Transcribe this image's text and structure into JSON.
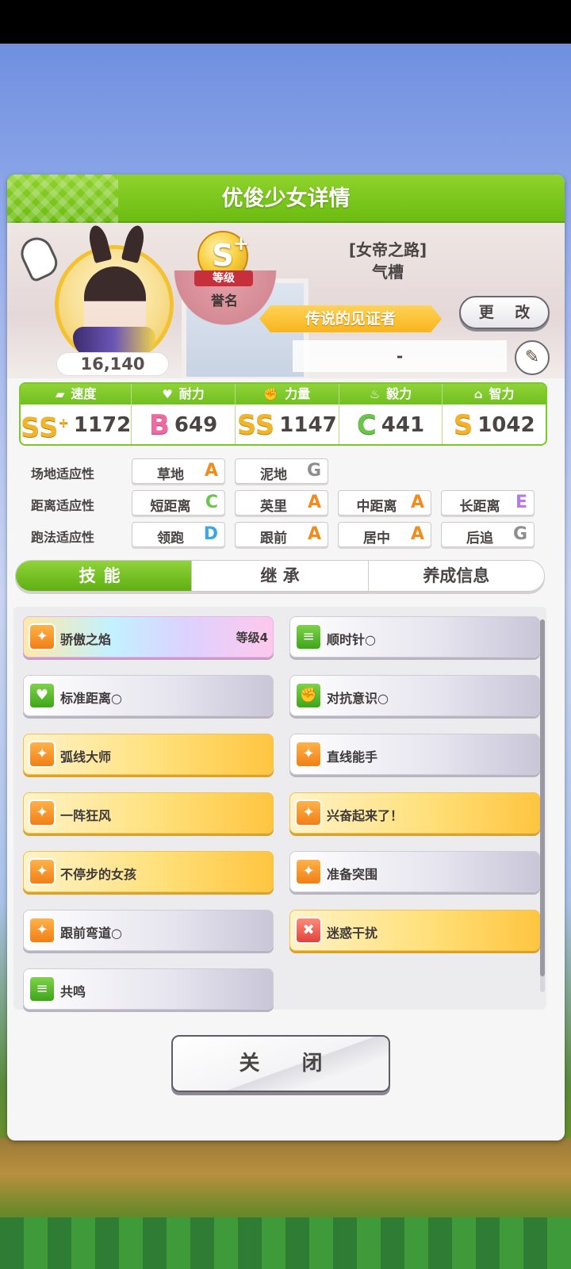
{
  "dialog": {
    "title": "优俊少女详情"
  },
  "profile": {
    "score": "16,140",
    "rank": {
      "letter": "S",
      "modifier": "+",
      "ribbon": "等级",
      "caption": "誉名"
    },
    "epithet_line1": "[女帝之路]",
    "epithet_line2": "气槽",
    "title_plate": "传说的见证者",
    "change_label": "更 改",
    "subtitle": "-"
  },
  "stats": [
    {
      "name": "速度",
      "icon": "shoe-icon",
      "grade": "SS",
      "grade_plus": "+",
      "value": "1172"
    },
    {
      "name": "耐力",
      "icon": "heart-icon",
      "grade": "B",
      "value": "649"
    },
    {
      "name": "力量",
      "icon": "arm-icon",
      "grade": "SS",
      "value": "1147"
    },
    {
      "name": "毅力",
      "icon": "flame-icon",
      "grade": "C",
      "value": "441"
    },
    {
      "name": "智力",
      "icon": "graduation-cap-icon",
      "grade": "S",
      "value": "1042"
    }
  ],
  "aptitude": {
    "track": {
      "label": "场地适应性",
      "items": [
        {
          "name": "草地",
          "rank": "A"
        },
        {
          "name": "泥地",
          "rank": "G"
        }
      ]
    },
    "distance": {
      "label": "距离适应性",
      "items": [
        {
          "name": "短距离",
          "rank": "C"
        },
        {
          "name": "英里",
          "rank": "A"
        },
        {
          "name": "中距离",
          "rank": "A"
        },
        {
          "name": "长距离",
          "rank": "E"
        }
      ]
    },
    "style": {
      "label": "跑法适应性",
      "items": [
        {
          "name": "领跑",
          "rank": "D"
        },
        {
          "name": "跟前",
          "rank": "A"
        },
        {
          "name": "居中",
          "rank": "A"
        },
        {
          "name": "后追",
          "rank": "G"
        }
      ]
    }
  },
  "tabs": {
    "skills": "技能",
    "inherit": "继 承",
    "training": "养成信息"
  },
  "skills": [
    {
      "name": "骄傲之焰",
      "level": "等级4",
      "style": "rainbow",
      "icon": "orange"
    },
    {
      "name": "顺时针○",
      "style": "silver",
      "icon": "green"
    },
    {
      "name": "标准距离○",
      "style": "silver",
      "icon": "green"
    },
    {
      "name": "对抗意识○",
      "style": "silver",
      "icon": "green"
    },
    {
      "name": "弧线大师",
      "style": "gold",
      "icon": "orange"
    },
    {
      "name": "直线能手",
      "style": "silver",
      "icon": "orange"
    },
    {
      "name": "一阵狂风",
      "style": "gold",
      "icon": "orange"
    },
    {
      "name": "兴奋起来了！",
      "style": "gold",
      "icon": "orange"
    },
    {
      "name": "不停步的女孩",
      "style": "gold",
      "icon": "orange"
    },
    {
      "name": "准备突围",
      "style": "silver",
      "icon": "orange"
    },
    {
      "name": "跟前弯道○",
      "style": "silver",
      "icon": "orange"
    },
    {
      "name": "迷惑干扰",
      "style": "gold",
      "icon": "red"
    },
    {
      "name": "共鸣",
      "style": "silver",
      "icon": "green"
    }
  ],
  "close_label": "关 闭"
}
